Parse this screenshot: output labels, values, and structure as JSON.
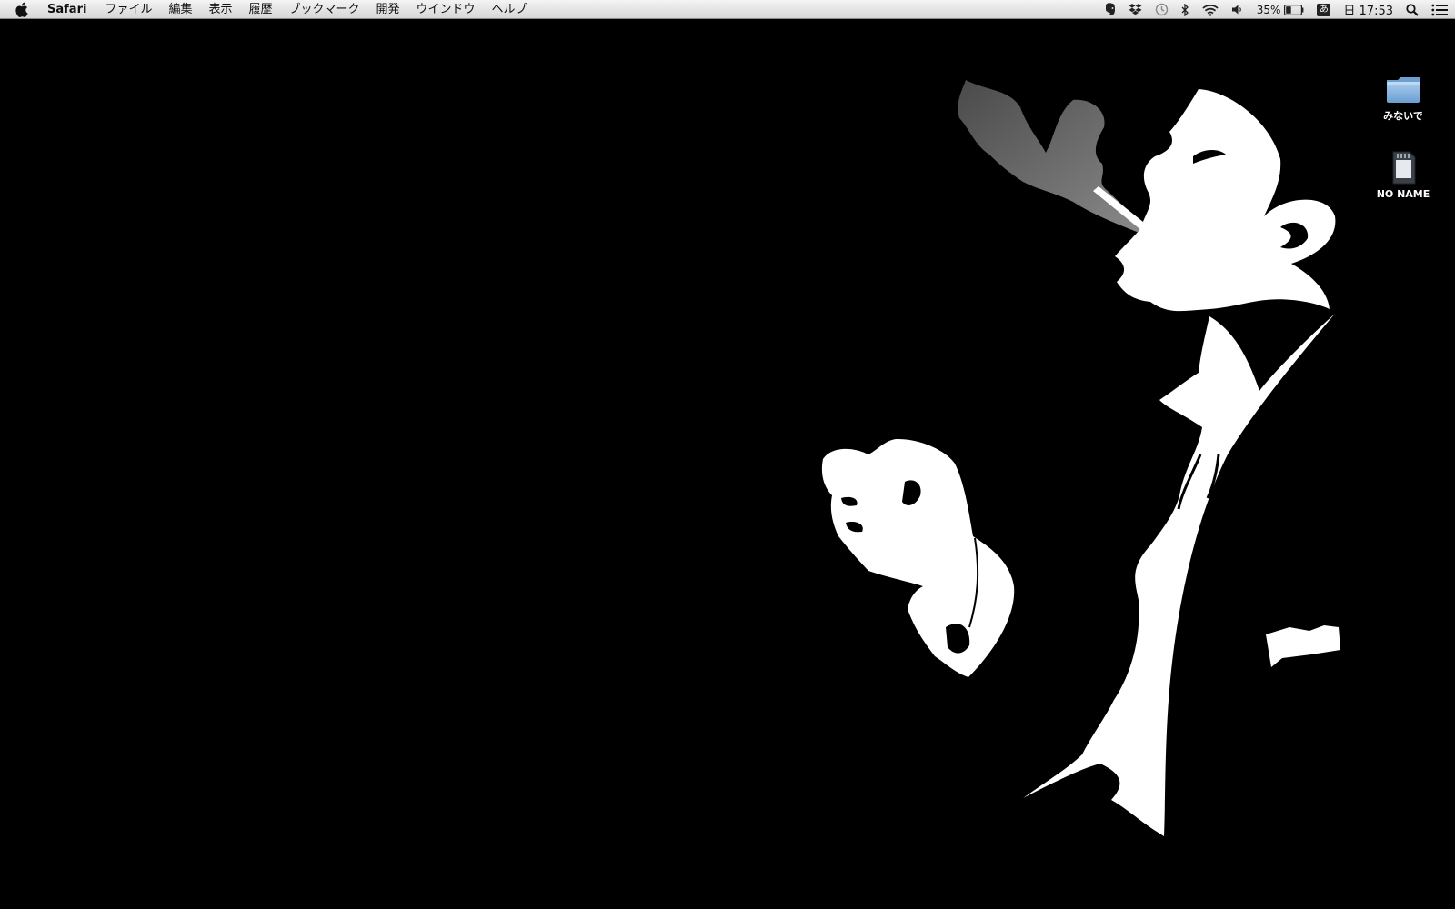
{
  "menubar": {
    "apple_icon": "apple-icon",
    "app_name": "Safari",
    "items": [
      "ファイル",
      "編集",
      "表示",
      "履歴",
      "ブックマーク",
      "開発",
      "ウインドウ",
      "ヘルプ"
    ],
    "status": {
      "evernote_icon": "evernote-icon",
      "dropbox_icon": "dropbox-icon",
      "time_machine_icon": "time-machine-icon",
      "bluetooth_icon": "bluetooth-icon",
      "wifi_icon": "wifi-icon",
      "volume_icon": "volume-icon",
      "battery_percent": "35%",
      "battery_level": 0.35,
      "input_method": "あ",
      "clock": "日 17:53",
      "spotlight_icon": "spotlight-icon",
      "notification_icon": "notification-center-icon"
    }
  },
  "desktop": {
    "icons": [
      {
        "label": "みないで",
        "icon": "folder-icon"
      },
      {
        "label": "NO NAME",
        "icon": "sd-card-icon"
      }
    ]
  },
  "wallpaper": {
    "description_icon": "smoking-man-silhouette",
    "colors": {
      "background": "#000000",
      "figure": "#ffffff",
      "smoke": "#6e6e6e"
    }
  }
}
